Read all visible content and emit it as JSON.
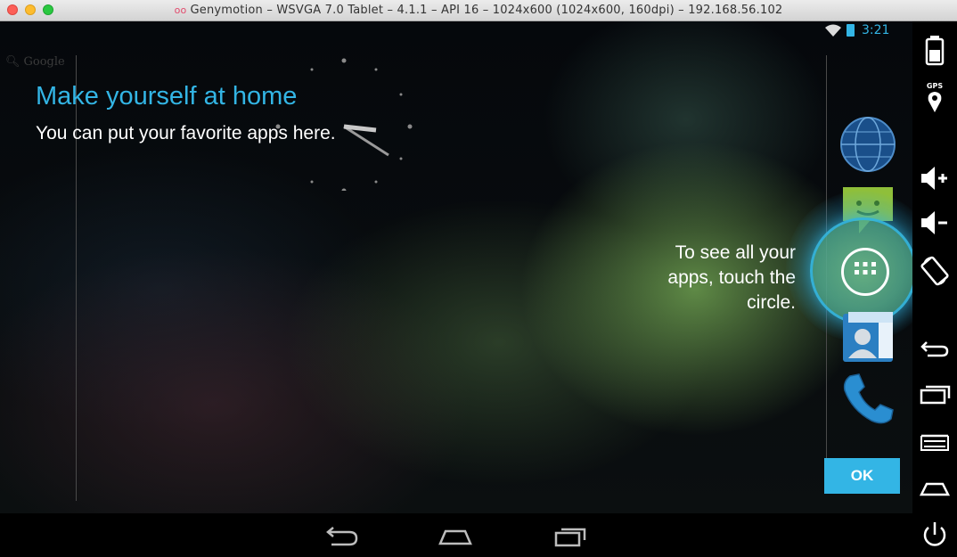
{
  "window": {
    "title": "Genymotion – WSVGA 7.0 Tablet – 4.1.1 – API 16 – 1024x600 (1024x600, 160dpi) – 192.168.56.102",
    "logo": "oo"
  },
  "statusbar": {
    "time": "3:21",
    "accent": "#33b5e5",
    "icons": [
      "wifi-icon",
      "battery-charging-icon"
    ]
  },
  "search": {
    "label": "Google",
    "icon": "search-icon"
  },
  "cling": {
    "title": "Make yourself at home",
    "description": "You can put your favorite apps here.",
    "allapps_hint": "To see all your apps, touch the circle.",
    "ok_label": "OK",
    "accent": "#33b5e5"
  },
  "hotseat": [
    "browser-icon",
    "messaging-icon",
    "all-apps-icon",
    "contacts-icon",
    "phone-icon"
  ],
  "navbar": [
    "back-icon",
    "home-icon",
    "recent-apps-icon"
  ],
  "sidepanel": {
    "gps_label": "GPS",
    "buttons": [
      "battery-icon",
      "gps-icon",
      "volume-up-icon",
      "volume-down-icon",
      "rotate-icon",
      "back-icon",
      "recent-apps-icon",
      "menu-icon",
      "home-icon",
      "power-icon"
    ]
  }
}
